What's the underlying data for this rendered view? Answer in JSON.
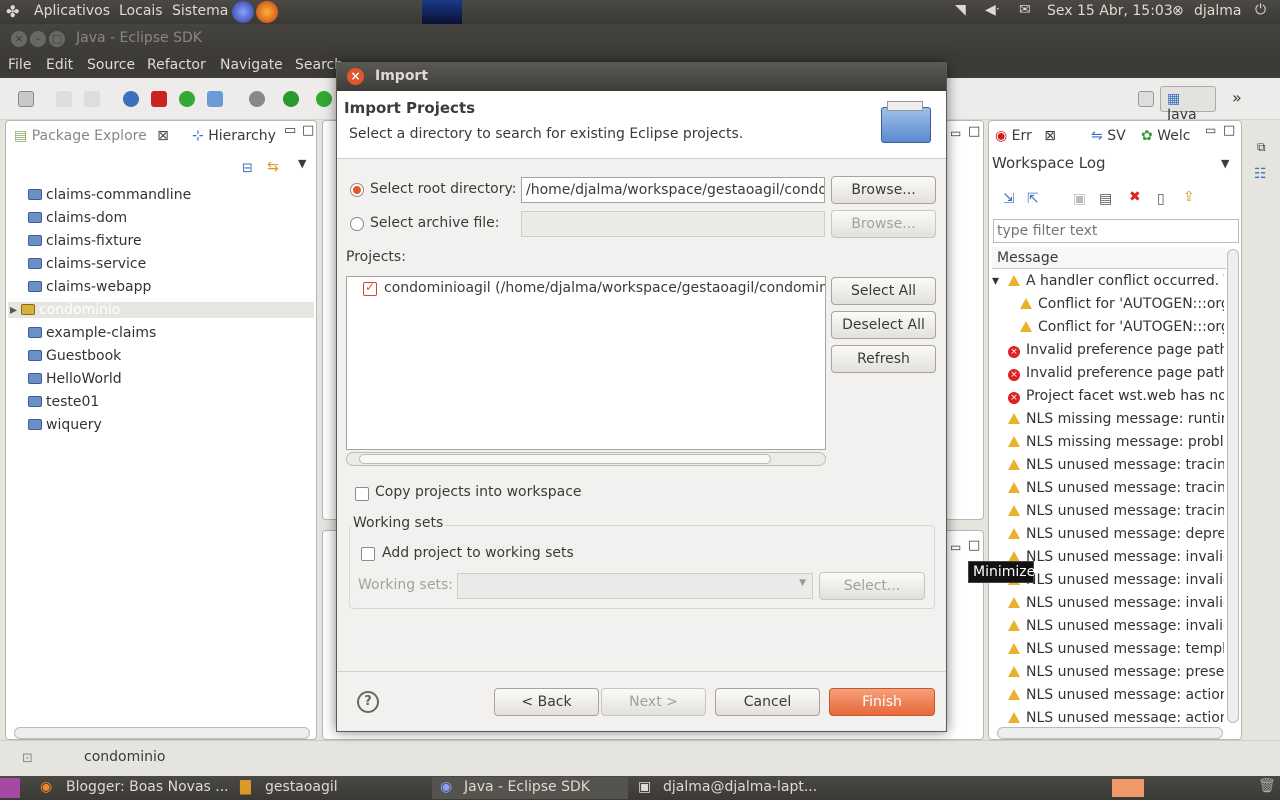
{
  "top_panel": {
    "menus": [
      "Aplicativos",
      "Locais",
      "Sistema"
    ],
    "datetime": "Sex 15 Abr, 15:03",
    "user": "djalma"
  },
  "window": {
    "title": "Java - Eclipse SDK"
  },
  "menubar": [
    "File",
    "Edit",
    "Source",
    "Refactor",
    "Navigate",
    "Search"
  ],
  "toolbar": {
    "perspective": "Java"
  },
  "package_explorer": {
    "tabs": [
      "Package Explore",
      "Hierarchy"
    ],
    "items": [
      "claims-commandline",
      "claims-dom",
      "claims-fixture",
      "claims-service",
      "claims-webapp",
      "condominio",
      "example-claims",
      "Guestbook",
      "HelloWorld",
      "teste01",
      "wiquery"
    ],
    "selected_index": 5
  },
  "right_view": {
    "tabs": [
      "Err",
      "SV",
      "Welc"
    ],
    "title": "Workspace Log",
    "filter_placeholder": "type filter text",
    "column_header": "Message",
    "rows": [
      {
        "icon": "warning",
        "text": "A handler conflict occurred.  T",
        "indent": 0
      },
      {
        "icon": "warning",
        "text": "Conflict for 'AUTOGEN:::org",
        "indent": 1
      },
      {
        "icon": "warning",
        "text": "Conflict for 'AUTOGEN:::org",
        "indent": 1
      },
      {
        "icon": "error",
        "text": "Invalid preference page path:",
        "indent": 0
      },
      {
        "icon": "error",
        "text": "Invalid preference page path:",
        "indent": 0
      },
      {
        "icon": "error",
        "text": "Project facet wst.web has not",
        "indent": 0
      },
      {
        "icon": "warning",
        "text": "NLS missing message: runtim",
        "indent": 0
      },
      {
        "icon": "warning",
        "text": "NLS missing message: proble",
        "indent": 0
      },
      {
        "icon": "warning",
        "text": "NLS unused message: tracingI",
        "indent": 0
      },
      {
        "icon": "warning",
        "text": "NLS unused message: tracingI",
        "indent": 0
      },
      {
        "icon": "warning",
        "text": "NLS unused message: tracing.",
        "indent": 0
      },
      {
        "icon": "warning",
        "text": "NLS unused message: depreca",
        "indent": 0
      },
      {
        "icon": "warning",
        "text": "NLS unused message: invalidC",
        "indent": 0
      },
      {
        "icon": "warning",
        "text": "NLS unused message: invalidF",
        "indent": 0
      },
      {
        "icon": "warning",
        "text": "NLS unused message: invalidE",
        "indent": 0
      },
      {
        "icon": "warning",
        "text": "NLS unused message: invalidA",
        "indent": 0
      },
      {
        "icon": "warning",
        "text": "NLS unused message: templat",
        "indent": 0
      },
      {
        "icon": "warning",
        "text": "NLS unused message: presetN",
        "indent": 0
      },
      {
        "icon": "warning",
        "text": "NLS unused message: actionA",
        "indent": 0
      },
      {
        "icon": "warning",
        "text": "NLS unused message: actionN",
        "indent": 0
      }
    ]
  },
  "tooltip": "Minimize",
  "status_bar": {
    "text": "condominio"
  },
  "dialog": {
    "title": "Import",
    "header_title": "Import Projects",
    "header_desc": "Select a directory to search for existing Eclipse projects.",
    "root_dir_label": "Select root directory:",
    "root_dir_value": "/home/djalma/workspace/gestaoagil/condominio",
    "archive_label": "Select archive file:",
    "browse_label": "Browse...",
    "projects_label": "Projects:",
    "projects": [
      "condominioagil (/home/djalma/workspace/gestaoagil/condominio)"
    ],
    "select_all": "Select All",
    "deselect_all": "Deselect All",
    "refresh": "Refresh",
    "copy_label": "Copy projects into workspace",
    "working_sets_group": "Working sets",
    "add_to_ws_label": "Add project to working sets",
    "working_sets_label": "Working sets:",
    "select_ws": "Select...",
    "back": "< Back",
    "next": "Next >",
    "cancel": "Cancel",
    "finish": "Finish"
  },
  "taskbar": {
    "tasks": [
      "Blogger: Boas Novas ...",
      "gestaoagil",
      "Java - Eclipse SDK",
      "djalma@djalma-lapt..."
    ]
  },
  "colors": {
    "accent": "#e0582a",
    "panel": "#3c3b37"
  }
}
